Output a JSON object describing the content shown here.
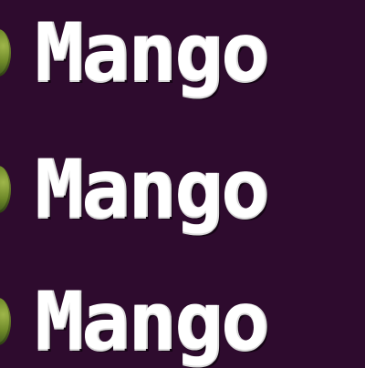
{
  "inventory": {
    "items": [
      {
        "label": "Mango",
        "icon": "mango-icon"
      },
      {
        "label": "Mango",
        "icon": "mango-icon"
      },
      {
        "label": "Mango",
        "icon": "mango-icon"
      }
    ]
  },
  "colors": {
    "background": "#2e0b2e",
    "text": "#ffffff",
    "icon": "#6f8a2a"
  }
}
